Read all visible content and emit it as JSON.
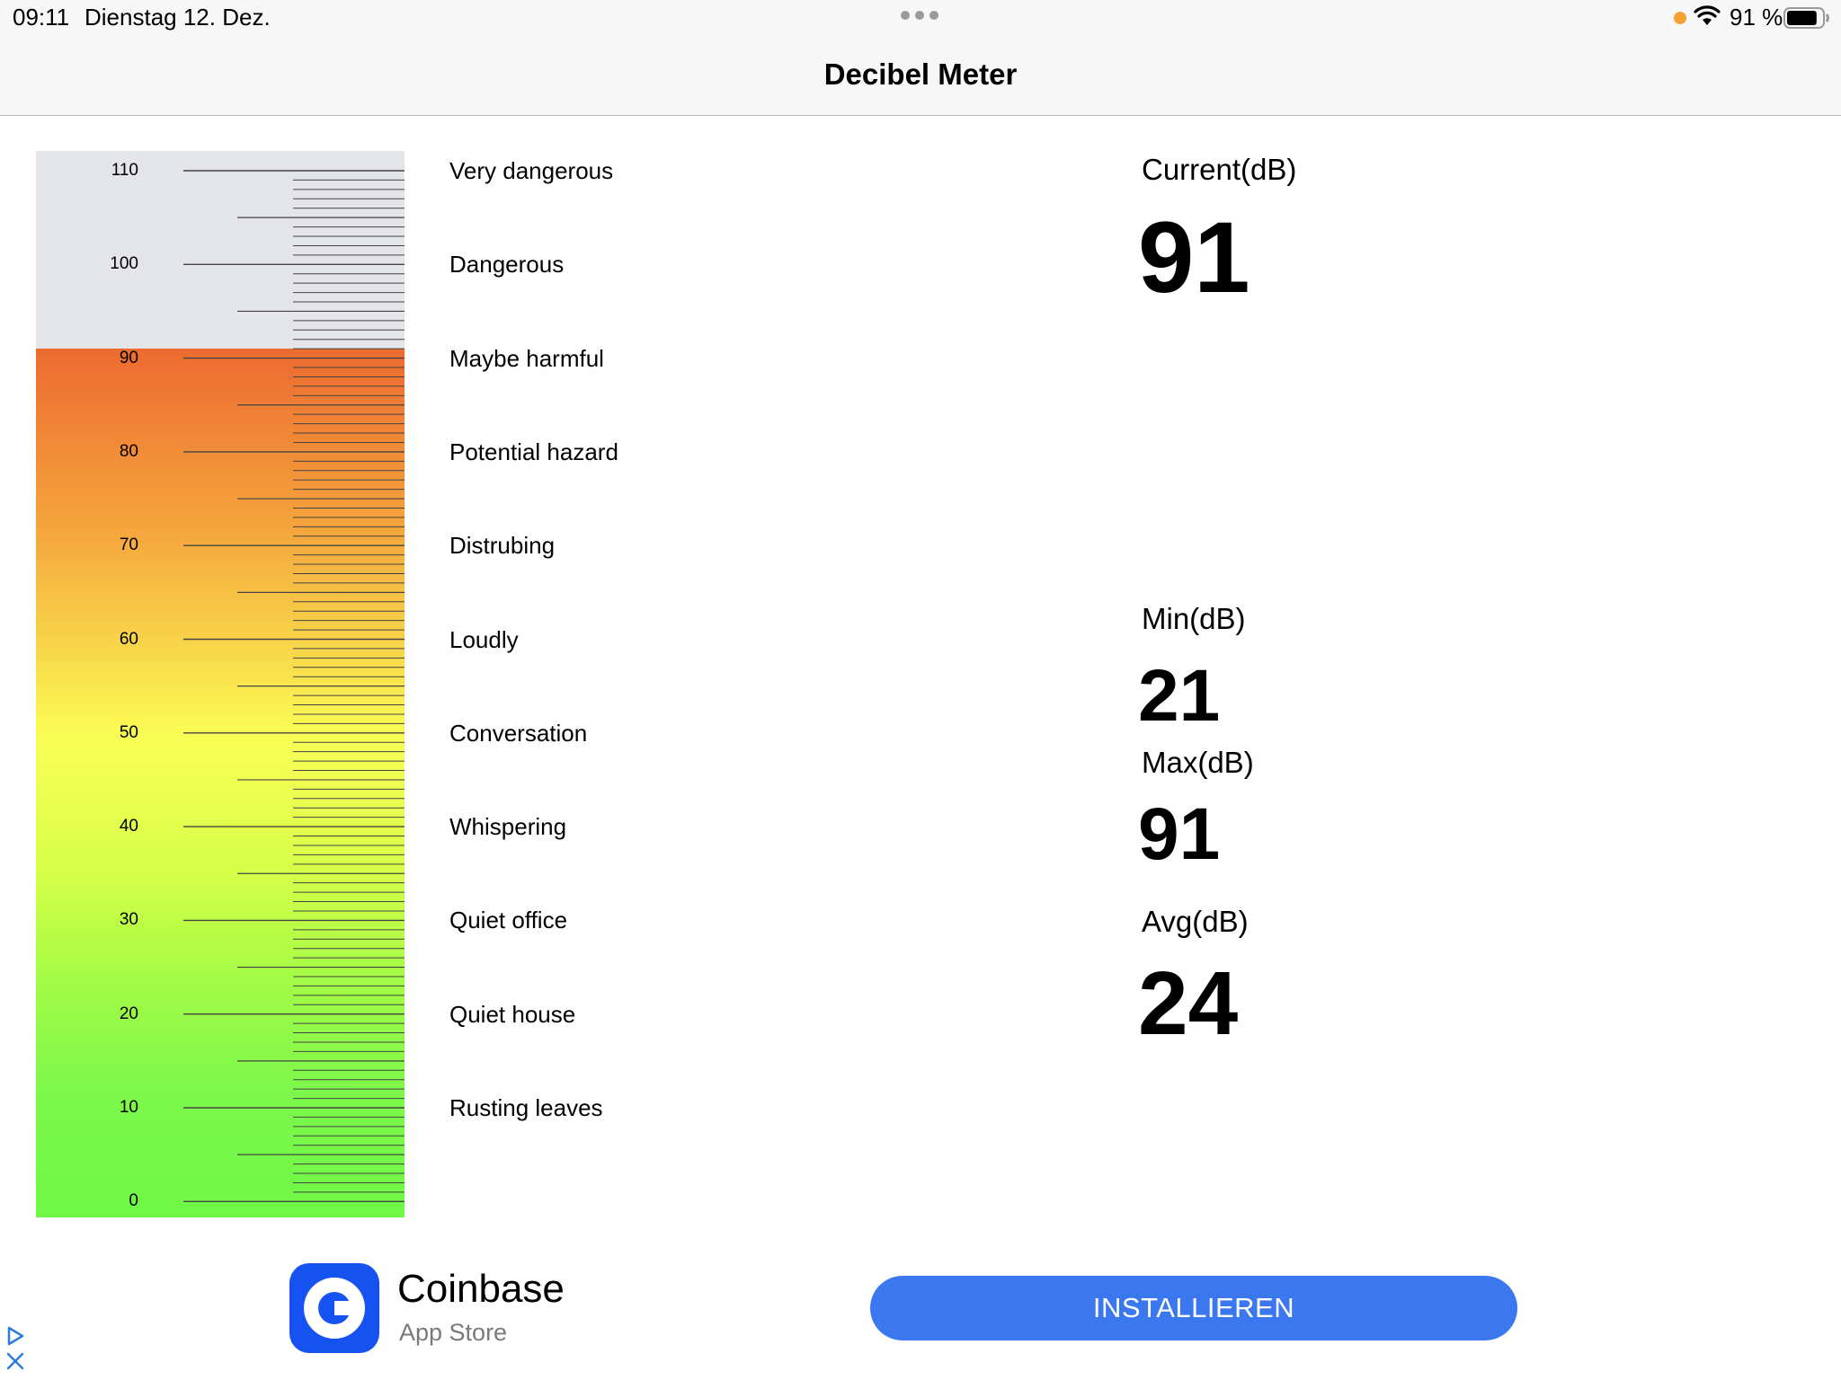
{
  "status_bar": {
    "time": "09:11",
    "date": "Dienstag 12. Dez.",
    "battery_percent": "91 %",
    "battery_level": 0.91,
    "recording_indicator_color": "#f5a033"
  },
  "nav": {
    "title": "Decibel Meter"
  },
  "meter": {
    "scale": [
      "110",
      "100",
      "90",
      "80",
      "70",
      "60",
      "50",
      "40",
      "30",
      "20",
      "10",
      "0"
    ],
    "zones": [
      "Very dangerous",
      "Dangerous",
      "Maybe harmful",
      "Potential hazard",
      "Distrubing",
      "Loudly",
      "Conversation",
      "Whispering",
      "Quiet office",
      "Quiet house",
      "Rusting leaves"
    ],
    "current_level_db": 91,
    "colors": {
      "top": "#e3e5e8",
      "hot": "#ec6b30",
      "mid": "#faff55",
      "low": "#6ff846"
    }
  },
  "stats": {
    "current": {
      "label": "Current(dB)",
      "value": "91"
    },
    "min": {
      "label": "Min(dB)",
      "value": "21"
    },
    "max": {
      "label": "Max(dB)",
      "value": "91"
    },
    "avg": {
      "label": "Avg(dB)",
      "value": "24"
    }
  },
  "ad": {
    "app_name": "Coinbase",
    "store": "App Store",
    "button_label": "INSTALLIEREN",
    "button_color": "#3b78ef",
    "icon": "coinbase-logo"
  }
}
